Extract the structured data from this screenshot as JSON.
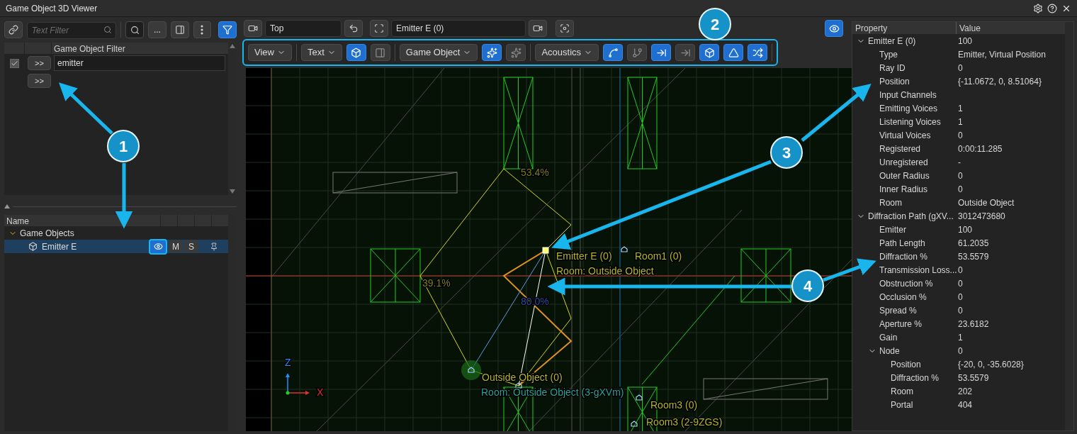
{
  "window": {
    "title": "Game Object 3D Viewer"
  },
  "left_toolbar": {
    "text_filter": {
      "placeholder": "Text Filter"
    },
    "more_button": "...",
    "filter_on": true
  },
  "filter_table": {
    "column": "Game Object Filter",
    "rows": [
      {
        "kind": "filter",
        "checked": true,
        "button": ">>",
        "value": "emitter"
      },
      {
        "kind": "add",
        "button": ">>"
      }
    ]
  },
  "tree": {
    "column": "Name",
    "items": [
      {
        "label": "Game Objects",
        "expanded": true,
        "selected": false,
        "children": [
          {
            "label": "Emitter E",
            "selected": true,
            "visible": true,
            "mute": "M",
            "solo": "S"
          }
        ]
      }
    ]
  },
  "camera_bar": {
    "camera": "Top",
    "target": "Emitter E (0)",
    "eye_on": true
  },
  "toolbar": [
    {
      "kind": "dropdown",
      "label": "View"
    },
    {
      "kind": "separator"
    },
    {
      "kind": "dropdown",
      "label": "Text"
    },
    {
      "kind": "toggle",
      "on": true
    },
    {
      "kind": "toggle",
      "on": false
    },
    {
      "kind": "separator"
    },
    {
      "kind": "dropdown",
      "label": "Game Object"
    },
    {
      "kind": "toggle",
      "on": true
    },
    {
      "kind": "toggle",
      "on": false
    },
    {
      "kind": "separator"
    },
    {
      "kind": "dropdown",
      "label": "Acoustics"
    },
    {
      "kind": "toggle",
      "on": true
    },
    {
      "kind": "toggle",
      "on": false
    },
    {
      "kind": "toggle",
      "on": true
    },
    {
      "kind": "toggle",
      "on": false
    },
    {
      "kind": "toggle",
      "on": true
    },
    {
      "kind": "toggle",
      "on": true
    },
    {
      "kind": "toggle",
      "on": true
    },
    {
      "kind": "separator"
    }
  ],
  "viewport_labels": [
    {
      "text": "53.4%",
      "color": "#7d7d1c"
    },
    {
      "text": "39.1%",
      "color": "#7d7d1c"
    },
    {
      "text": "80.0%",
      "color": "#2c4c9c"
    },
    {
      "text": "Emitter  E (0)",
      "color": "#b5b521"
    },
    {
      "text": "Room1 (0)",
      "color": "#b5b521"
    },
    {
      "text": "Room: Outside Object",
      "color": "#b5b521"
    },
    {
      "text": "Outside Object (0)",
      "color": "#b5b521"
    },
    {
      "text": "Room: Outside Object (3-gXVm)",
      "color": "#2aa198"
    },
    {
      "text": "Room3 (0)",
      "color": "#b5b521"
    },
    {
      "text": "Room3 (2-9ZGS)",
      "color": "#b5b521"
    },
    {
      "text": "Z",
      "color": "#1e90ff"
    },
    {
      "text": "X",
      "color": "#e03030"
    }
  ],
  "properties": {
    "columns": [
      "Property",
      "Value"
    ],
    "rows": [
      {
        "name": "Emitter E (0)",
        "value": "100",
        "expanded": true,
        "children": [
          {
            "name": "Type",
            "value": "Emitter, Virtual Position"
          },
          {
            "name": "Ray ID",
            "value": "0"
          },
          {
            "name": "Position",
            "value": "{-11.0672, 0, 8.51064}"
          },
          {
            "name": "Input Channels"
          },
          {
            "name": "Emitting Voices",
            "value": "1"
          },
          {
            "name": "Listening Voices",
            "value": "1"
          },
          {
            "name": "Virtual Voices",
            "value": "0"
          },
          {
            "name": "Registered",
            "value": "0:00:11.285"
          },
          {
            "name": "Unregistered",
            "value": "-"
          },
          {
            "name": "Outer Radius",
            "value": "0"
          },
          {
            "name": "Inner Radius",
            "value": "0"
          },
          {
            "name": "Room",
            "value": "Outside Object"
          }
        ]
      },
      {
        "name": "Diffraction Path (gXV...",
        "value": "3012473680",
        "expanded": true,
        "children": [
          {
            "name": "Emitter",
            "value": "100"
          },
          {
            "name": "Path Length",
            "value": "61.2035"
          },
          {
            "name": "Diffraction %",
            "value": "53.5579"
          },
          {
            "name": "Transmission Loss...",
            "value": "0"
          },
          {
            "name": "Obstruction %",
            "value": "0"
          },
          {
            "name": "Occlusion %",
            "value": "0"
          },
          {
            "name": "Spread %",
            "value": "0"
          },
          {
            "name": "Aperture %",
            "value": "23.6182"
          },
          {
            "name": "Gain",
            "value": "1"
          },
          {
            "name": "Node",
            "value": "0",
            "expanded": true,
            "children": [
              {
                "name": "Position",
                "value": "{-20, 0, -35.6028}"
              },
              {
                "name": "Diffraction %",
                "value": "53.5579"
              },
              {
                "name": "Room",
                "value": "202"
              },
              {
                "name": "Portal",
                "value": "404"
              }
            ]
          }
        ]
      }
    ]
  },
  "callouts": [
    "1",
    "2",
    "3",
    "4"
  ]
}
